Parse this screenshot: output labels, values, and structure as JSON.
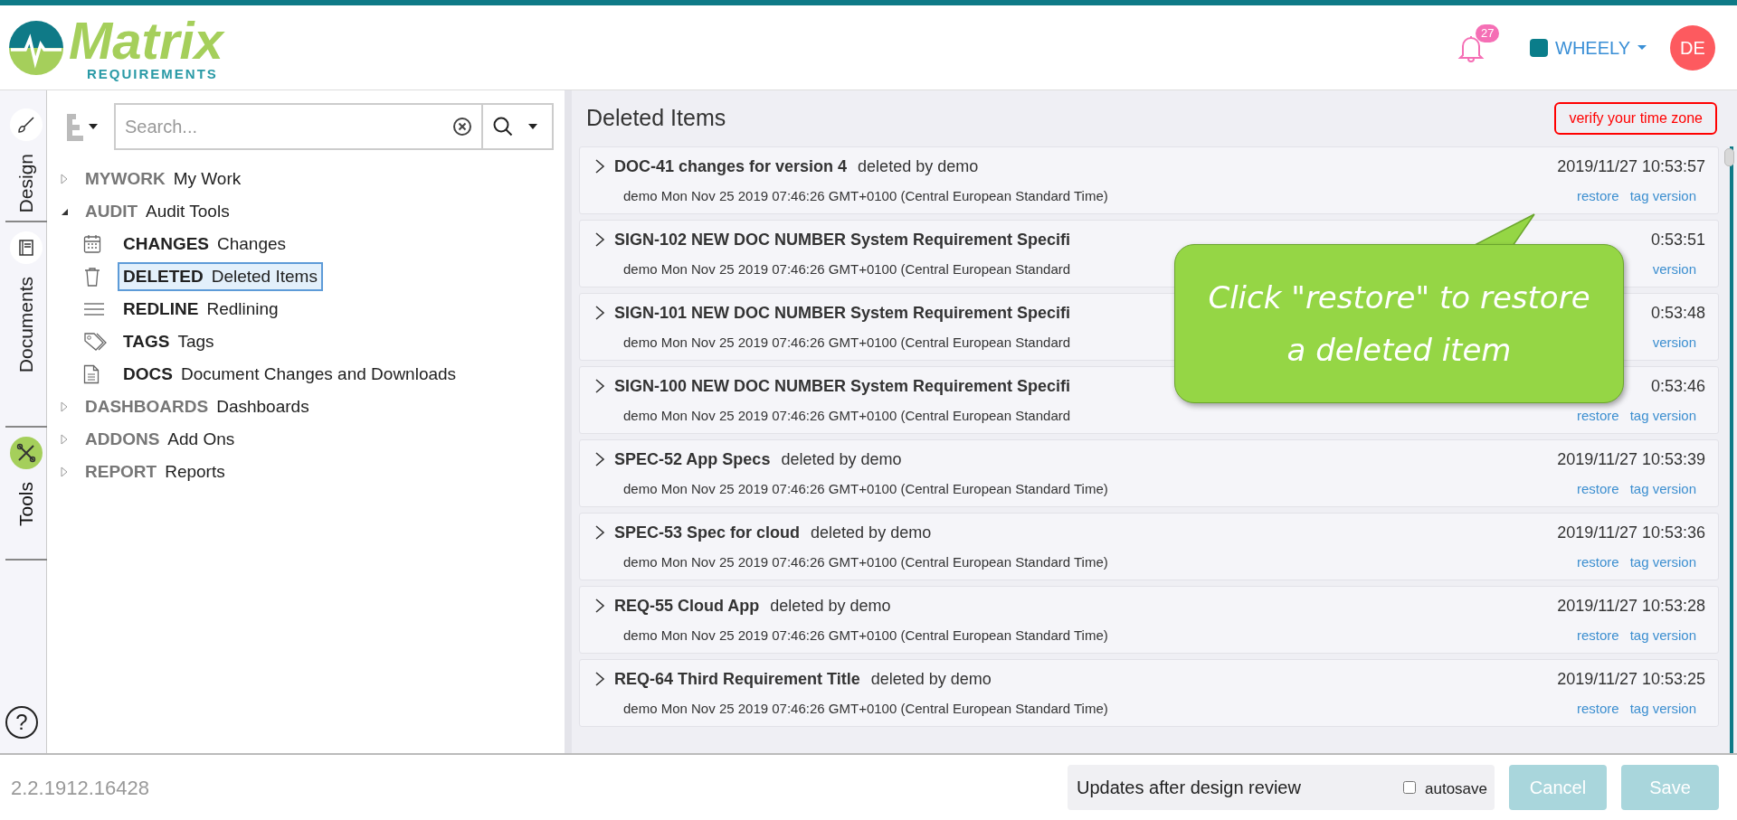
{
  "header": {
    "logo": {
      "name": "Matrix",
      "tagline": "REQUIREMENTS"
    },
    "notification_count": "27",
    "project": {
      "name": "WHEELY",
      "color": "#0a7d8a"
    },
    "user_initials": "DE"
  },
  "side_tabs": [
    {
      "label": "Design",
      "selected": false
    },
    {
      "label": "Documents",
      "selected": false
    },
    {
      "label": "Tools",
      "selected": true
    }
  ],
  "help": "?",
  "tree": {
    "search_placeholder": "Search...",
    "items": [
      {
        "code": "MYWORK",
        "label": "My Work",
        "expanded": false
      },
      {
        "code": "AUDIT",
        "label": "Audit Tools",
        "expanded": true,
        "children": [
          {
            "code": "CHANGES",
            "label": "Changes",
            "selected": false
          },
          {
            "code": "DELETED",
            "label": "Deleted Items",
            "selected": true
          },
          {
            "code": "REDLINE",
            "label": "Redlining",
            "selected": false
          },
          {
            "code": "TAGS",
            "label": "Tags",
            "selected": false
          },
          {
            "code": "DOCS",
            "label": "Document Changes and Downloads",
            "selected": false
          }
        ]
      },
      {
        "code": "DASHBOARDS",
        "label": "Dashboards",
        "expanded": false
      },
      {
        "code": "ADDONS",
        "label": "Add Ons",
        "expanded": false
      },
      {
        "code": "REPORT",
        "label": "Reports",
        "expanded": false
      }
    ]
  },
  "main": {
    "title": "Deleted Items",
    "timezone_button": "verify your time zone",
    "rows": [
      {
        "title": "DOC-41 changes for version 4",
        "deleted_by": "deleted by demo",
        "subtitle": "demo Mon Nov 25 2019 07:46:26 GMT+0100 (Central European Standard Time)",
        "time": "2019/11/27 10:53:57",
        "links": [
          "restore",
          "tag version"
        ]
      },
      {
        "title": "SIGN-102 NEW DOC NUMBER System Requirement Specifi",
        "subtitle": "demo Mon Nov 25 2019 07:46:26 GMT+0100 (Central European Standard",
        "time": "0:53:51",
        "links": [
          "version"
        ]
      },
      {
        "title": "SIGN-101 NEW DOC NUMBER System Requirement Specifi",
        "subtitle": "demo Mon Nov 25 2019 07:46:26 GMT+0100 (Central European Standard",
        "time": "0:53:48",
        "links": [
          "version"
        ]
      },
      {
        "title": "SIGN-100 NEW DOC NUMBER System Requirement Specifi",
        "subtitle": "demo Mon Nov 25 2019 07:46:26 GMT+0100 (Central European Standard",
        "time": "0:53:46",
        "links": [
          "restore",
          "tag version"
        ]
      },
      {
        "title": "SPEC-52 App Specs",
        "deleted_by": "deleted by demo",
        "subtitle": "demo Mon Nov 25 2019 07:46:26 GMT+0100 (Central European Standard Time)",
        "time": "2019/11/27 10:53:39",
        "links": [
          "restore",
          "tag version"
        ]
      },
      {
        "title": "SPEC-53 Spec for cloud",
        "deleted_by": "deleted by demo",
        "subtitle": "demo Mon Nov 25 2019 07:46:26 GMT+0100 (Central European Standard Time)",
        "time": "2019/11/27 10:53:36",
        "links": [
          "restore",
          "tag version"
        ]
      },
      {
        "title": "REQ-55 Cloud App",
        "deleted_by": "deleted by demo",
        "subtitle": "demo Mon Nov 25 2019 07:46:26 GMT+0100 (Central European Standard Time)",
        "time": "2019/11/27 10:53:28",
        "links": [
          "restore",
          "tag version"
        ]
      },
      {
        "title": "REQ-64 Third Requirement Title",
        "deleted_by": "deleted by demo",
        "subtitle": "demo Mon Nov 25 2019 07:46:26 GMT+0100 (Central European Standard Time)",
        "time": "2019/11/27 10:53:25",
        "links": [
          "restore",
          "tag version"
        ]
      }
    ],
    "callout": "Click \"restore\" to restore a deleted item"
  },
  "footer": {
    "version": "2.2.1912.16428",
    "comment": "Updates after design review",
    "autosave": {
      "label": "autosave",
      "checked": false
    },
    "buttons": [
      {
        "label": "Cancel",
        "disabled": true
      },
      {
        "label": "Save",
        "disabled": true
      }
    ]
  }
}
